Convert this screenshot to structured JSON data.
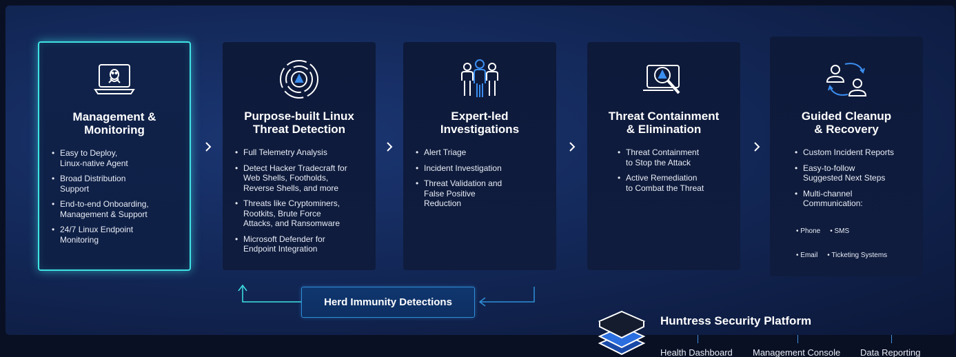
{
  "cards": [
    {
      "title": "Management &\nMonitoring",
      "icon": "linux-laptop-icon",
      "items": [
        "Easy to Deploy,\nLinux-native Agent",
        "Broad Distribution\nSupport",
        "End-to-end Onboarding,\nManagement & Support",
        "24/7 Linux Endpoint\nMonitoring"
      ]
    },
    {
      "title": "Purpose-built Linux\nThreat Detection",
      "icon": "target-radar-icon",
      "items": [
        "Full Telemetry Analysis",
        "Detect Hacker Tradecraft for\nWeb Shells, Footholds,\nReverse Shells, and more",
        "Threats like Cryptominers,\nRootkits, Brute Force\nAttacks, and Ransomware",
        "Microsoft Defender for\nEndpoint Integration"
      ]
    },
    {
      "title": "Expert-led\nInvestigations",
      "icon": "team-icon",
      "items": [
        "Alert Triage",
        "Incident Investigation",
        "Threat Validation and\nFalse Positive\nReduction"
      ]
    },
    {
      "title": "Threat Containment\n& Elimination",
      "icon": "laptop-magnifier-warning-icon",
      "items": [
        "Threat Containment\nto Stop the Attack",
        "Active Remediation\nto Combat the Threat"
      ]
    },
    {
      "title": "Guided Cleanup\n& Recovery",
      "icon": "users-exchange-icon",
      "items": [
        "Custom Incident Reports",
        "Easy-to-follow\nSuggested Next Steps",
        "Multi-channel\nCommunication:"
      ],
      "channels": [
        "Phone",
        "SMS",
        "Email",
        "Ticketing Systems"
      ]
    }
  ],
  "herd_label": "Herd Immunity Detections",
  "platform": {
    "title": "Huntress Security Platform",
    "items": [
      "Health Dashboard",
      "Management Console",
      "Data Reporting"
    ]
  },
  "colors": {
    "accent_cyan": "#3fe3e6",
    "accent_blue": "#2f8fd8",
    "background": "#142a5c"
  }
}
